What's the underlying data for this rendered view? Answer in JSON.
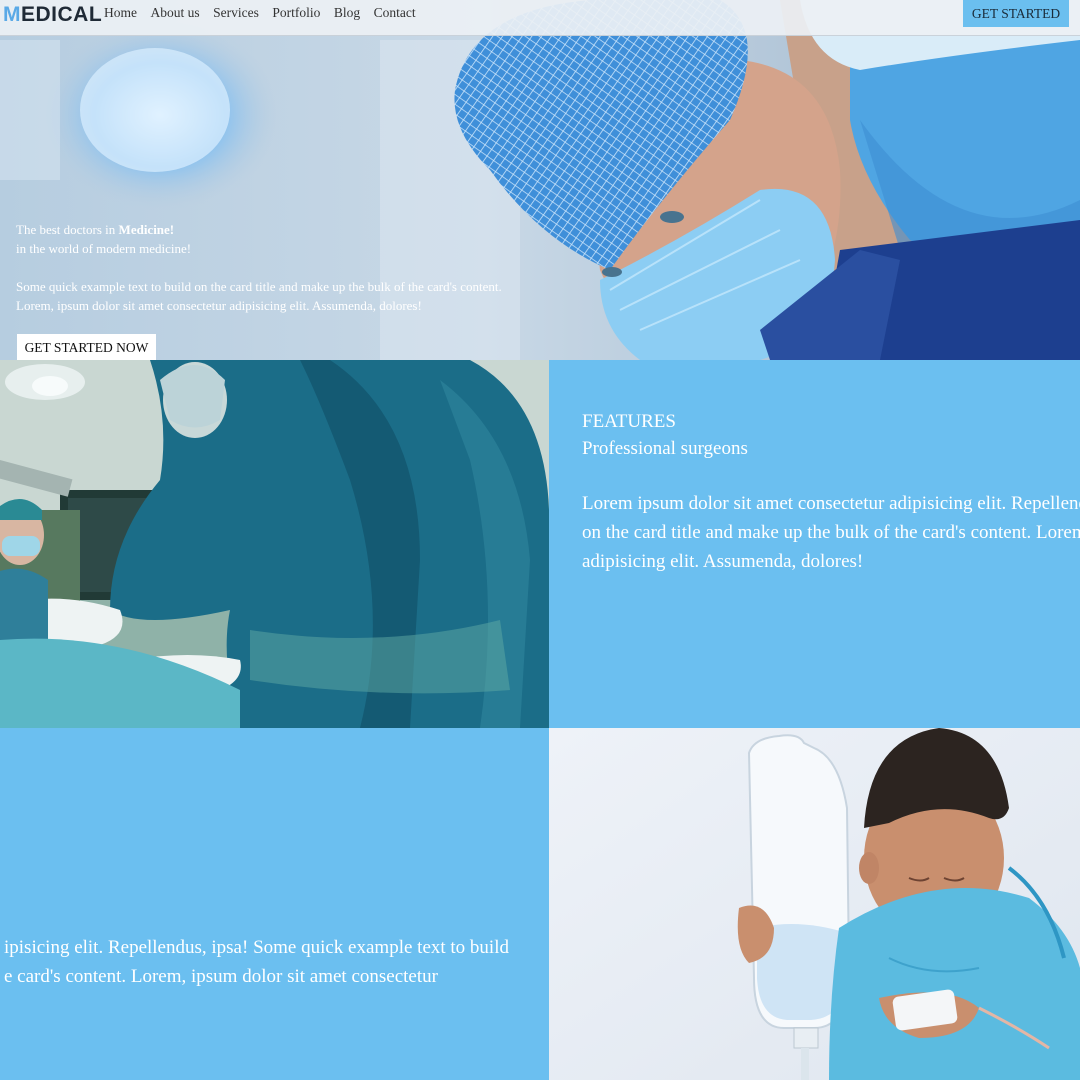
{
  "nav": {
    "logo_first": "M",
    "logo_rest": "EDICAL",
    "links": [
      "Home",
      "About us",
      "Services",
      "Portfolio",
      "Blog",
      "Contact"
    ],
    "cta": "GET STARTED"
  },
  "hero": {
    "line1_prefix": "The best doctors in ",
    "line1_bold": "Medicine!",
    "line2": "in the world of modern medicine!",
    "body_line1": "Some quick example text to build on the card title and make up the bulk of the card's content.",
    "body_line2": "Lorem, ipsum dolor sit amet consectetur adipisicing elit. Assumenda, dolores!",
    "button": "GET STARTED NOW"
  },
  "features": {
    "title": "FEATURES",
    "subtitle": "Professional surgeons",
    "body_lines": [
      "Lorem ipsum dolor sit amet consectetur adipisicing elit. Repellendus, ipsa! Some quick example text to build",
      "on the card title and make up the bulk of the card's content. Lorem, ipsum dolor sit amet consectetur",
      "adipisicing elit. Assumenda, dolores!"
    ]
  },
  "second_block": {
    "body_lines": [
      "ipisicing elit. Repellendus, ipsa! Some quick example text to build",
      "e card's content. Lorem, ipsum dolor sit amet consectetur"
    ]
  },
  "colors": {
    "accent": "#6bbff0",
    "nav_bg": "#ecf0f4",
    "logo_m": "#5aa9e6"
  }
}
